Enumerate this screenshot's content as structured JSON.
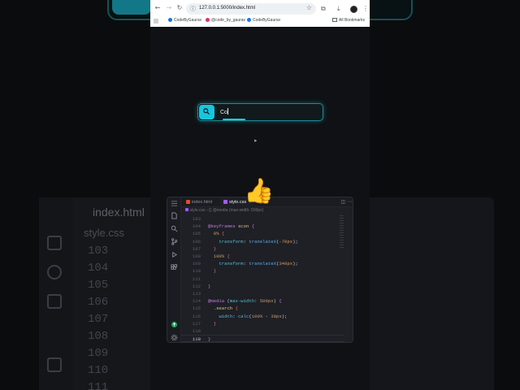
{
  "browser": {
    "url": "127.0.0.1:5000/index.html",
    "bookmarks": [
      "CodeByGaurav",
      "@code_by_gaurav",
      "CodeByGaurav"
    ],
    "all_bookmarks": "All Bookmarks",
    "icons": [
      "back-icon",
      "forward-icon",
      "reload-icon",
      "star-icon",
      "extensions-icon",
      "download-icon",
      "menu-icon"
    ]
  },
  "search": {
    "value": "Co",
    "icon": "search-icon",
    "accent": "#16c6df"
  },
  "reaction": {
    "emoji": "👍"
  },
  "editor": {
    "tabs": [
      {
        "label": "index.html",
        "active": false
      },
      {
        "label": "style.css",
        "active": true
      }
    ],
    "breadcrumb": [
      "style.css",
      "{} @media (max-width: 500px)"
    ],
    "lines": [
      {
        "n": "103",
        "code": ""
      },
      {
        "n": "104",
        "code": "@keyframes scon {"
      },
      {
        "n": "105",
        "code": "  0% {"
      },
      {
        "n": "106",
        "code": "    transform: translateX(-70px);"
      },
      {
        "n": "107",
        "code": "  }"
      },
      {
        "n": "108",
        "code": "  100% {"
      },
      {
        "n": "109",
        "code": "    transform: translateX(340px);"
      },
      {
        "n": "110",
        "code": "  }"
      },
      {
        "n": "111",
        "code": ""
      },
      {
        "n": "112",
        "code": "}"
      },
      {
        "n": "113",
        "code": ""
      },
      {
        "n": "114",
        "code": "@media (max-width: 500px) {"
      },
      {
        "n": "115",
        "code": "  .search {"
      },
      {
        "n": "116",
        "code": "    width: calc(100% - 30px);"
      },
      {
        "n": "117",
        "code": "  }"
      },
      {
        "n": "118",
        "code": ""
      },
      {
        "n": "119",
        "code": "}"
      }
    ]
  },
  "background_editor": {
    "tab": "index.html",
    "tab2": "style.css",
    "line_numbers": [
      "103",
      "104",
      "105",
      "106",
      "107",
      "108",
      "109",
      "110",
      "111"
    ]
  }
}
